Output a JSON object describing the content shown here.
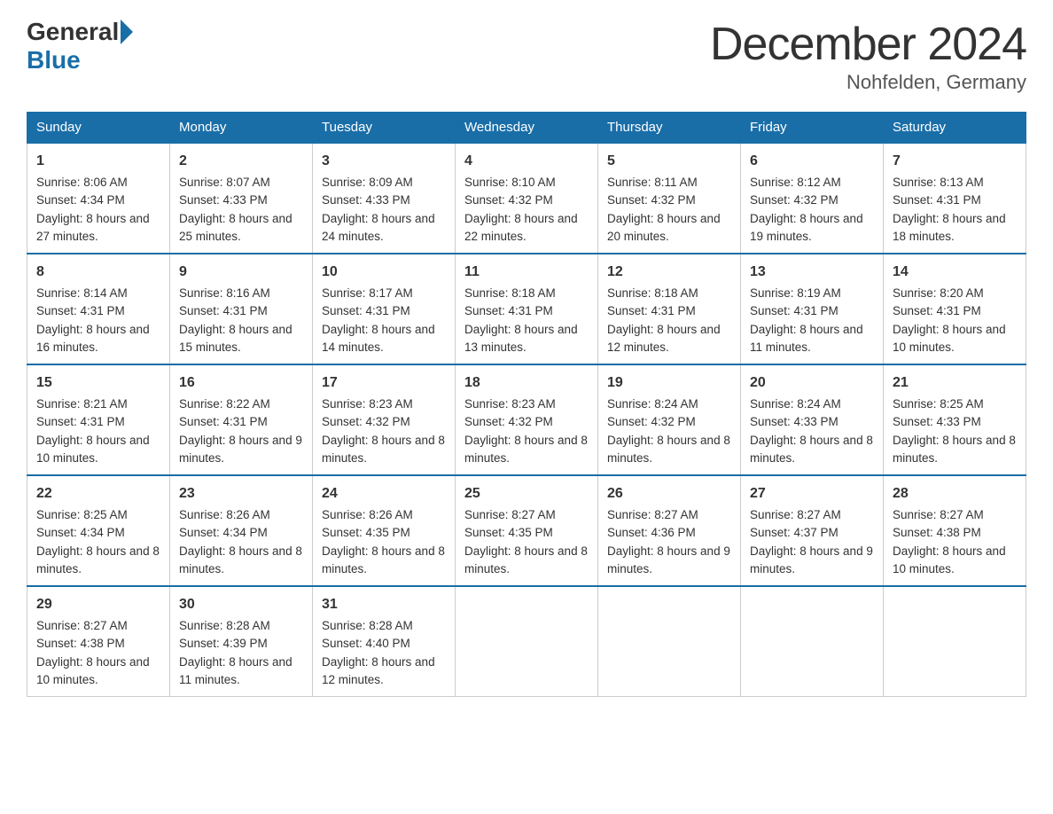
{
  "logo": {
    "general": "General",
    "blue": "Blue"
  },
  "title": "December 2024",
  "subtitle": "Nohfelden, Germany",
  "headers": [
    "Sunday",
    "Monday",
    "Tuesday",
    "Wednesday",
    "Thursday",
    "Friday",
    "Saturday"
  ],
  "weeks": [
    [
      {
        "day": "1",
        "sunrise": "8:06 AM",
        "sunset": "4:34 PM",
        "daylight": "8 hours and 27 minutes."
      },
      {
        "day": "2",
        "sunrise": "8:07 AM",
        "sunset": "4:33 PM",
        "daylight": "8 hours and 25 minutes."
      },
      {
        "day": "3",
        "sunrise": "8:09 AM",
        "sunset": "4:33 PM",
        "daylight": "8 hours and 24 minutes."
      },
      {
        "day": "4",
        "sunrise": "8:10 AM",
        "sunset": "4:32 PM",
        "daylight": "8 hours and 22 minutes."
      },
      {
        "day": "5",
        "sunrise": "8:11 AM",
        "sunset": "4:32 PM",
        "daylight": "8 hours and 20 minutes."
      },
      {
        "day": "6",
        "sunrise": "8:12 AM",
        "sunset": "4:32 PM",
        "daylight": "8 hours and 19 minutes."
      },
      {
        "day": "7",
        "sunrise": "8:13 AM",
        "sunset": "4:31 PM",
        "daylight": "8 hours and 18 minutes."
      }
    ],
    [
      {
        "day": "8",
        "sunrise": "8:14 AM",
        "sunset": "4:31 PM",
        "daylight": "8 hours and 16 minutes."
      },
      {
        "day": "9",
        "sunrise": "8:16 AM",
        "sunset": "4:31 PM",
        "daylight": "8 hours and 15 minutes."
      },
      {
        "day": "10",
        "sunrise": "8:17 AM",
        "sunset": "4:31 PM",
        "daylight": "8 hours and 14 minutes."
      },
      {
        "day": "11",
        "sunrise": "8:18 AM",
        "sunset": "4:31 PM",
        "daylight": "8 hours and 13 minutes."
      },
      {
        "day": "12",
        "sunrise": "8:18 AM",
        "sunset": "4:31 PM",
        "daylight": "8 hours and 12 minutes."
      },
      {
        "day": "13",
        "sunrise": "8:19 AM",
        "sunset": "4:31 PM",
        "daylight": "8 hours and 11 minutes."
      },
      {
        "day": "14",
        "sunrise": "8:20 AM",
        "sunset": "4:31 PM",
        "daylight": "8 hours and 10 minutes."
      }
    ],
    [
      {
        "day": "15",
        "sunrise": "8:21 AM",
        "sunset": "4:31 PM",
        "daylight": "8 hours and 10 minutes."
      },
      {
        "day": "16",
        "sunrise": "8:22 AM",
        "sunset": "4:31 PM",
        "daylight": "8 hours and 9 minutes."
      },
      {
        "day": "17",
        "sunrise": "8:23 AM",
        "sunset": "4:32 PM",
        "daylight": "8 hours and 8 minutes."
      },
      {
        "day": "18",
        "sunrise": "8:23 AM",
        "sunset": "4:32 PM",
        "daylight": "8 hours and 8 minutes."
      },
      {
        "day": "19",
        "sunrise": "8:24 AM",
        "sunset": "4:32 PM",
        "daylight": "8 hours and 8 minutes."
      },
      {
        "day": "20",
        "sunrise": "8:24 AM",
        "sunset": "4:33 PM",
        "daylight": "8 hours and 8 minutes."
      },
      {
        "day": "21",
        "sunrise": "8:25 AM",
        "sunset": "4:33 PM",
        "daylight": "8 hours and 8 minutes."
      }
    ],
    [
      {
        "day": "22",
        "sunrise": "8:25 AM",
        "sunset": "4:34 PM",
        "daylight": "8 hours and 8 minutes."
      },
      {
        "day": "23",
        "sunrise": "8:26 AM",
        "sunset": "4:34 PM",
        "daylight": "8 hours and 8 minutes."
      },
      {
        "day": "24",
        "sunrise": "8:26 AM",
        "sunset": "4:35 PM",
        "daylight": "8 hours and 8 minutes."
      },
      {
        "day": "25",
        "sunrise": "8:27 AM",
        "sunset": "4:35 PM",
        "daylight": "8 hours and 8 minutes."
      },
      {
        "day": "26",
        "sunrise": "8:27 AM",
        "sunset": "4:36 PM",
        "daylight": "8 hours and 9 minutes."
      },
      {
        "day": "27",
        "sunrise": "8:27 AM",
        "sunset": "4:37 PM",
        "daylight": "8 hours and 9 minutes."
      },
      {
        "day": "28",
        "sunrise": "8:27 AM",
        "sunset": "4:38 PM",
        "daylight": "8 hours and 10 minutes."
      }
    ],
    [
      {
        "day": "29",
        "sunrise": "8:27 AM",
        "sunset": "4:38 PM",
        "daylight": "8 hours and 10 minutes."
      },
      {
        "day": "30",
        "sunrise": "8:28 AM",
        "sunset": "4:39 PM",
        "daylight": "8 hours and 11 minutes."
      },
      {
        "day": "31",
        "sunrise": "8:28 AM",
        "sunset": "4:40 PM",
        "daylight": "8 hours and 12 minutes."
      },
      null,
      null,
      null,
      null
    ]
  ]
}
